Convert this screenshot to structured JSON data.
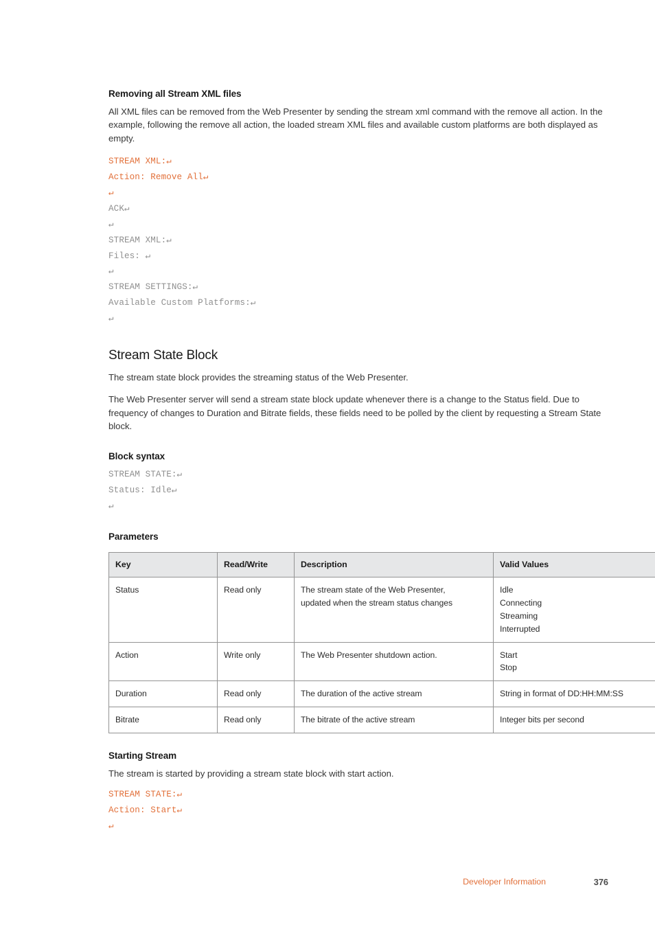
{
  "document": {
    "sections": {
      "removing": {
        "heading": "Removing all Stream XML files",
        "paragraph": "All XML files can be removed from the Web Presenter by sending the stream xml command with the remove all action. In the example, following the remove all action, the loaded stream XML files and available custom platforms are both displayed as empty.",
        "code_sent": [
          "STREAM XML:↵",
          "Action: Remove All↵",
          "↵"
        ],
        "code_received": [
          "ACK↵",
          "↵",
          "STREAM XML:↵",
          "Files: ↵",
          "↵",
          "STREAM SETTINGS:↵",
          "Available Custom Platforms:↵",
          "↵"
        ]
      },
      "stream_state_block": {
        "heading": "Stream State Block",
        "paragraph_1": "The stream state block provides the streaming status of the Web Presenter.",
        "paragraph_2": "The Web Presenter server will send a stream state block update whenever there is a change to the Status field. Due to frequency of changes to Duration and Bitrate fields, these fields need to be polled by the client by requesting a Stream State block.",
        "block_syntax": {
          "heading": "Block syntax",
          "lines": [
            "STREAM STATE:↵",
            "Status: Idle↵",
            "↵"
          ]
        },
        "parameters": {
          "heading": "Parameters",
          "columns": [
            "Key",
            "Read/Write",
            "Description",
            "Valid Values"
          ],
          "rows": [
            {
              "key": "Status",
              "read_write": "Read only",
              "description": [
                "The stream state of the Web Presenter,",
                "updated when the stream status changes"
              ],
              "valid_values": [
                "Idle",
                "Connecting",
                "Streaming",
                "Interrupted"
              ]
            },
            {
              "key": "Action",
              "read_write": "Write only",
              "description": [
                "The Web Presenter shutdown action."
              ],
              "valid_values": [
                "Start",
                "Stop"
              ]
            },
            {
              "key": "Duration",
              "read_write": "Read only",
              "description": [
                "The duration of the active stream"
              ],
              "valid_values": [
                "String in format of DD:HH:MM:SS"
              ]
            },
            {
              "key": "Bitrate",
              "read_write": "Read only",
              "description": [
                "The bitrate of the active stream"
              ],
              "valid_values": [
                "Integer bits per second"
              ]
            }
          ]
        }
      },
      "starting_stream": {
        "heading": "Starting Stream",
        "paragraph": "The stream is started by providing a stream state block with start action.",
        "code": [
          "STREAM STATE:↵",
          "Action: Start↵",
          "↵"
        ]
      }
    }
  },
  "footer": {
    "label": "Developer Information",
    "page_number": "376"
  },
  "colors": {
    "accent_orange": "#e2703a",
    "code_gray": "#8f8f8f",
    "table_header_bg": "#e6e7e8",
    "table_border": "#939393",
    "body_text": "#363636"
  }
}
